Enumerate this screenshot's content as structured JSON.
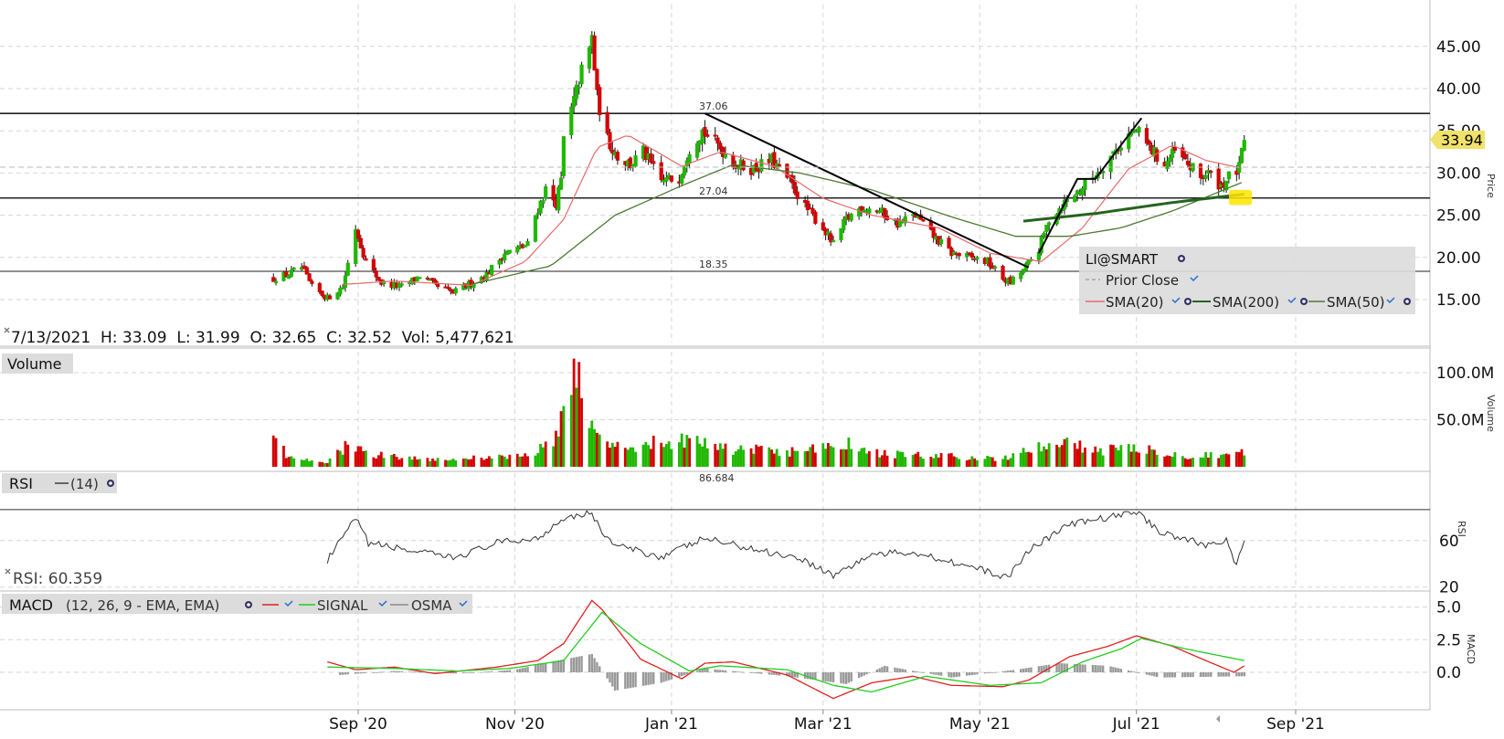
{
  "symbol": "LI@SMART",
  "ohlc_readout": "7/13/2021  H: 33.09  L: 31.99  O: 32.65  C: 32.52  Vol: 5,477,621",
  "last_price": "33.94",
  "colors": {
    "up": "#1fb800",
    "down": "#d40000",
    "sma20": "#e66a6a",
    "sma50": "#4d7a32",
    "sma200": "#24641f",
    "highlight": "#ffe400",
    "rsi": "#333333",
    "macd": "#e02020",
    "signal": "#22cc22",
    "osma": "#999999"
  },
  "x_axis": {
    "labels": [
      "Sep '20",
      "Nov '20",
      "Jan '21",
      "Mar '21",
      "May '21",
      "Jul '21",
      "Sep '21"
    ]
  },
  "price_panel": {
    "axis_title": "Price",
    "ticks": [
      "15.00",
      "20.00",
      "25.00",
      "30.00",
      "35.00",
      "40.00",
      "45.00"
    ],
    "hlines": [
      {
        "label": "37.06",
        "value": 37.06
      },
      {
        "label": "27.04",
        "value": 27.04
      },
      {
        "label": "18.35",
        "value": 18.35
      }
    ],
    "legend": {
      "title": "LI@SMART",
      "prior_close": "Prior Close",
      "sma20": "SMA(20)",
      "sma200": "SMA(200)",
      "sma50": "SMA(50)"
    }
  },
  "volume_panel": {
    "title": "Volume",
    "axis_title": "Volume",
    "ticks": [
      "50.0M",
      "100.0M"
    ]
  },
  "rsi_panel": {
    "title": "RSI",
    "param": "(14)",
    "readout": "RSI: 60.359",
    "axis_title": "RSI",
    "ticks": [
      "20",
      "60"
    ],
    "top_label": "86.684"
  },
  "macd_panel": {
    "title": "MACD",
    "params": "(12, 26, 9 - EMA, EMA)",
    "signal": "SIGNAL",
    "osma": "OSMA",
    "axis_title": "MACD",
    "ticks": [
      "0.0",
      "2.5",
      "5.0"
    ]
  },
  "chart_data": {
    "type": "candlestick",
    "date_range": [
      "2020-07-30",
      "2021-07-13"
    ],
    "ylim": [
      12,
      49.5
    ],
    "price_anchors": [
      [
        "2020-07-30",
        17.5
      ],
      [
        "2020-08-05",
        18.0
      ],
      [
        "2020-08-10",
        18.8
      ],
      [
        "2020-08-14",
        16.5
      ],
      [
        "2020-08-20",
        15.2
      ],
      [
        "2020-08-26",
        16.5
      ],
      [
        "2020-08-31",
        23.5
      ],
      [
        "2020-09-04",
        19.5
      ],
      [
        "2020-09-10",
        17.0
      ],
      [
        "2020-09-18",
        16.5
      ],
      [
        "2020-09-25",
        17.8
      ],
      [
        "2020-10-02",
        16.5
      ],
      [
        "2020-10-08",
        15.8
      ],
      [
        "2020-10-14",
        16.8
      ],
      [
        "2020-10-21",
        18.0
      ],
      [
        "2020-10-28",
        20.5
      ],
      [
        "2020-11-02",
        21.0
      ],
      [
        "2020-11-06",
        21.5
      ],
      [
        "2020-11-09",
        25.0
      ],
      [
        "2020-11-13",
        28.0
      ],
      [
        "2020-11-17",
        26.5
      ],
      [
        "2020-11-19",
        29.0
      ],
      [
        "2020-11-20",
        34.0
      ],
      [
        "2020-11-24",
        38.5
      ],
      [
        "2020-11-27",
        42.0
      ],
      [
        "2020-11-30",
        44.5
      ],
      [
        "2020-12-01",
        46.0
      ],
      [
        "2020-12-03",
        39.0
      ],
      [
        "2020-12-07",
        34.0
      ],
      [
        "2020-12-11",
        32.0
      ],
      [
        "2020-12-16",
        31.0
      ],
      [
        "2020-12-21",
        32.5
      ],
      [
        "2020-12-28",
        29.0
      ],
      [
        "2021-01-04",
        29.5
      ],
      [
        "2021-01-08",
        33.0
      ],
      [
        "2021-01-13",
        35.0
      ],
      [
        "2021-01-20",
        33.0
      ],
      [
        "2021-01-26",
        31.0
      ],
      [
        "2021-02-02",
        30.5
      ],
      [
        "2021-02-09",
        31.5
      ],
      [
        "2021-02-16",
        29.0
      ],
      [
        "2021-02-22",
        26.0
      ],
      [
        "2021-03-01",
        23.5
      ],
      [
        "2021-03-05",
        21.5
      ],
      [
        "2021-03-10",
        24.5
      ],
      [
        "2021-03-16",
        26.0
      ],
      [
        "2021-03-23",
        25.5
      ],
      [
        "2021-03-30",
        24.0
      ],
      [
        "2021-04-06",
        25.0
      ],
      [
        "2021-04-13",
        22.5
      ],
      [
        "2021-04-20",
        20.5
      ],
      [
        "2021-04-27",
        20.0
      ],
      [
        "2021-05-04",
        19.5
      ],
      [
        "2021-05-10",
        17.5
      ],
      [
        "2021-05-13",
        17.0
      ],
      [
        "2021-05-18",
        18.5
      ],
      [
        "2021-05-24",
        21.0
      ],
      [
        "2021-05-28",
        24.5
      ],
      [
        "2021-06-03",
        26.5
      ],
      [
        "2021-06-09",
        28.0
      ],
      [
        "2021-06-14",
        29.5
      ],
      [
        "2021-06-21",
        32.0
      ],
      [
        "2021-06-28",
        34.5
      ],
      [
        "2021-07-01",
        35.0
      ],
      [
        "2021-07-06",
        33.0
      ],
      [
        "2021-07-12",
        31.0
      ],
      [
        "2021-07-16",
        32.5
      ],
      [
        "2021-07-21",
        31.0
      ],
      [
        "2021-07-26",
        29.5
      ],
      [
        "2021-07-29",
        30.0
      ],
      [
        "2021-08-03",
        28.5
      ],
      [
        "2021-08-06",
        29.5
      ],
      [
        "2021-08-10",
        30.5
      ],
      [
        "2021-08-12",
        33.94
      ]
    ],
    "sma20": [
      [
        "2020-08-26",
        16.8
      ],
      [
        "2020-09-15",
        17.2
      ],
      [
        "2020-10-15",
        16.7
      ],
      [
        "2020-11-05",
        19.5
      ],
      [
        "2020-11-20",
        24.5
      ],
      [
        "2020-12-03",
        33.0
      ],
      [
        "2020-12-15",
        34.5
      ],
      [
        "2021-01-05",
        30.8
      ],
      [
        "2021-01-20",
        32.5
      ],
      [
        "2021-02-10",
        30.8
      ],
      [
        "2021-03-01",
        27.0
      ],
      [
        "2021-03-20",
        25.0
      ],
      [
        "2021-04-15",
        23.5
      ],
      [
        "2021-05-05",
        20.5
      ],
      [
        "2021-05-25",
        19.5
      ],
      [
        "2021-06-10",
        23.5
      ],
      [
        "2021-06-28",
        30.5
      ],
      [
        "2021-07-15",
        33.3
      ],
      [
        "2021-07-28",
        31.5
      ],
      [
        "2021-08-12",
        30.5
      ]
    ],
    "sma50": [
      [
        "2020-10-15",
        16.8
      ],
      [
        "2020-11-15",
        19.0
      ],
      [
        "2020-12-10",
        25.0
      ],
      [
        "2021-01-05",
        28.5
      ],
      [
        "2021-01-25",
        31.0
      ],
      [
        "2021-02-20",
        30.0
      ],
      [
        "2021-03-20",
        28.0
      ],
      [
        "2021-04-20",
        24.8
      ],
      [
        "2021-05-15",
        22.5
      ],
      [
        "2021-06-05",
        22.5
      ],
      [
        "2021-06-25",
        23.5
      ],
      [
        "2021-07-15",
        25.5
      ],
      [
        "2021-08-12",
        29.0
      ]
    ],
    "sma200": [
      [
        "2021-05-18",
        24.3
      ],
      [
        "2021-06-15",
        25.2
      ],
      [
        "2021-07-15",
        26.5
      ],
      [
        "2021-08-12",
        27.5
      ]
    ],
    "trend_lines": [
      {
        "points": [
          [
            "2021-01-14",
            37.06
          ],
          [
            "2021-05-20",
            18.8
          ]
        ]
      },
      {
        "points": [
          [
            "2021-05-24",
            20.5
          ],
          [
            "2021-06-08",
            29.3
          ],
          [
            "2021-06-15",
            29.3
          ],
          [
            "2021-07-03",
            36.5
          ]
        ]
      }
    ],
    "highlight": {
      "x0": "2021-08-06",
      "x1": "2021-08-15",
      "y0": 26.2,
      "y1": 28.0
    },
    "volume": {
      "ylim": [
        0,
        140
      ],
      "anchors": [
        [
          "2020-07-30",
          55
        ],
        [
          "2020-08-04",
          10
        ],
        [
          "2020-08-20",
          5
        ],
        [
          "2020-08-28",
          26
        ],
        [
          "2020-09-05",
          15
        ],
        [
          "2020-10-01",
          9
        ],
        [
          "2020-11-01",
          12
        ],
        [
          "2020-11-15",
          25
        ],
        [
          "2020-11-20",
          72
        ],
        [
          "2020-11-24",
          138
        ],
        [
          "2020-11-27",
          75
        ],
        [
          "2020-12-03",
          38
        ],
        [
          "2020-12-15",
          25
        ],
        [
          "2021-01-05",
          33
        ],
        [
          "2021-01-20",
          22
        ],
        [
          "2021-02-20",
          17
        ],
        [
          "2021-03-10",
          28
        ],
        [
          "2021-03-25",
          15
        ],
        [
          "2021-04-15",
          13
        ],
        [
          "2021-05-10",
          9
        ],
        [
          "2021-05-20",
          20
        ],
        [
          "2021-06-03",
          29
        ],
        [
          "2021-06-15",
          18
        ],
        [
          "2021-07-01",
          25
        ],
        [
          "2021-07-20",
          13
        ],
        [
          "2021-08-12",
          16
        ]
      ]
    },
    "rsi": {
      "ylim": [
        10,
        95
      ],
      "anchors": [
        [
          "2020-08-20",
          43
        ],
        [
          "2020-08-31",
          79
        ],
        [
          "2020-09-05",
          58
        ],
        [
          "2020-09-20",
          52
        ],
        [
          "2020-10-08",
          45
        ],
        [
          "2020-10-25",
          58
        ],
        [
          "2020-11-10",
          62
        ],
        [
          "2020-11-20",
          80
        ],
        [
          "2020-12-01",
          84
        ],
        [
          "2020-12-04",
          70
        ],
        [
          "2020-12-10",
          56
        ],
        [
          "2020-12-28",
          46
        ],
        [
          "2021-01-14",
          62
        ],
        [
          "2021-02-01",
          53
        ],
        [
          "2021-02-20",
          45
        ],
        [
          "2021-03-05",
          30
        ],
        [
          "2021-03-20",
          48
        ],
        [
          "2021-04-05",
          50
        ],
        [
          "2021-04-20",
          42
        ],
        [
          "2021-05-12",
          28
        ],
        [
          "2021-05-20",
          52
        ],
        [
          "2021-06-05",
          74
        ],
        [
          "2021-06-20",
          80
        ],
        [
          "2021-07-01",
          85
        ],
        [
          "2021-07-10",
          68
        ],
        [
          "2021-07-28",
          56
        ],
        [
          "2021-08-05",
          61
        ],
        [
          "2021-08-09",
          38
        ],
        [
          "2021-08-12",
          60
        ]
      ]
    },
    "macd": {
      "ylim": [
        -2.7,
        6.2
      ],
      "macd_line": [
        [
          "2020-08-20",
          0.8
        ],
        [
          "2020-08-31",
          0.2
        ],
        [
          "2020-09-15",
          0.4
        ],
        [
          "2020-10-01",
          -0.1
        ],
        [
          "2020-10-25",
          0.4
        ],
        [
          "2020-11-10",
          0.9
        ],
        [
          "2020-11-20",
          2.2
        ],
        [
          "2020-12-01",
          5.5
        ],
        [
          "2020-12-05",
          4.8
        ],
        [
          "2020-12-20",
          1.0
        ],
        [
          "2021-01-05",
          -0.5
        ],
        [
          "2021-01-14",
          0.7
        ],
        [
          "2021-01-25",
          0.8
        ],
        [
          "2021-02-15",
          -0.2
        ],
        [
          "2021-03-05",
          -2.0
        ],
        [
          "2021-03-20",
          -0.8
        ],
        [
          "2021-04-05",
          -0.3
        ],
        [
          "2021-04-20",
          -1.0
        ],
        [
          "2021-05-10",
          -1.1
        ],
        [
          "2021-05-20",
          -0.6
        ],
        [
          "2021-06-05",
          1.2
        ],
        [
          "2021-06-20",
          2.0
        ],
        [
          "2021-07-01",
          2.8
        ],
        [
          "2021-07-15",
          2.0
        ],
        [
          "2021-07-28",
          0.9
        ],
        [
          "2021-08-08",
          0.0
        ],
        [
          "2021-08-12",
          0.5
        ]
      ],
      "signal_line": [
        [
          "2020-08-20",
          0.4
        ],
        [
          "2020-09-15",
          0.3
        ],
        [
          "2020-10-10",
          0.1
        ],
        [
          "2020-10-30",
          0.3
        ],
        [
          "2020-11-20",
          0.9
        ],
        [
          "2020-12-05",
          4.6
        ],
        [
          "2020-12-20",
          2.2
        ],
        [
          "2021-01-08",
          0.1
        ],
        [
          "2021-01-20",
          0.5
        ],
        [
          "2021-02-15",
          0.2
        ],
        [
          "2021-03-05",
          -1.0
        ],
        [
          "2021-03-20",
          -1.5
        ],
        [
          "2021-04-10",
          -0.3
        ],
        [
          "2021-05-05",
          -1.0
        ],
        [
          "2021-05-25",
          -0.8
        ],
        [
          "2021-06-10",
          0.8
        ],
        [
          "2021-06-25",
          1.8
        ],
        [
          "2021-07-03",
          2.6
        ],
        [
          "2021-07-20",
          1.8
        ],
        [
          "2021-08-12",
          0.9
        ]
      ],
      "osma": [
        [
          "2020-08-25",
          -0.2
        ],
        [
          "2020-09-15",
          0.1
        ],
        [
          "2020-10-10",
          -0.1
        ],
        [
          "2020-11-01",
          0.2
        ],
        [
          "2020-11-15",
          0.8
        ],
        [
          "2020-12-01",
          1.4
        ],
        [
          "2020-12-10",
          -1.4
        ],
        [
          "2020-12-28",
          -0.8
        ],
        [
          "2021-01-14",
          0.3
        ],
        [
          "2021-02-15",
          -0.3
        ],
        [
          "2021-03-10",
          -0.9
        ],
        [
          "2021-03-25",
          0.5
        ],
        [
          "2021-04-20",
          -0.4
        ],
        [
          "2021-05-15",
          0.2
        ],
        [
          "2021-06-01",
          0.7
        ],
        [
          "2021-06-20",
          0.5
        ],
        [
          "2021-07-10",
          -0.4
        ],
        [
          "2021-08-12",
          -0.3
        ]
      ]
    }
  }
}
